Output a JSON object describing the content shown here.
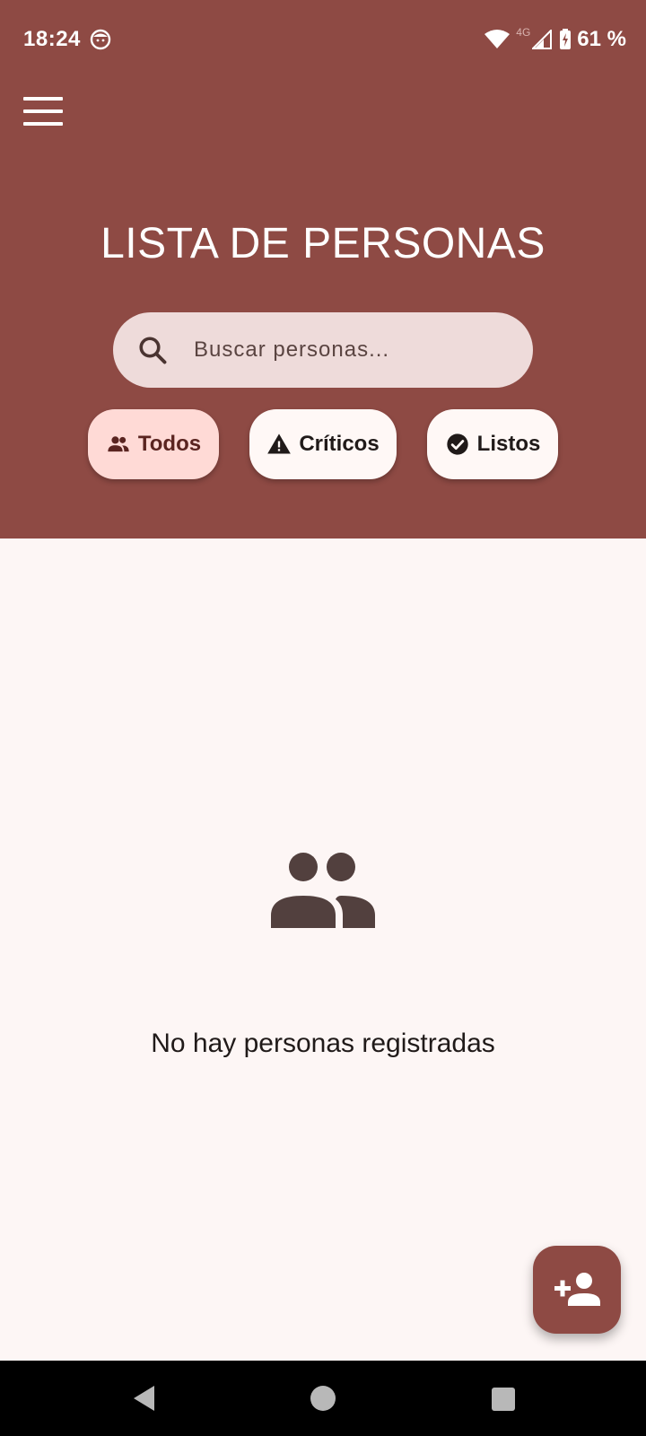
{
  "status_bar": {
    "time": "18:24",
    "network": "4G",
    "battery": "61 %"
  },
  "header": {
    "title": "LISTA DE PERSONAS",
    "search": {
      "placeholder": "Buscar personas...",
      "value": ""
    },
    "filters": [
      {
        "label": "Todos",
        "icon": "group-icon",
        "selected": true
      },
      {
        "label": "Críticos",
        "icon": "warning-icon",
        "selected": false
      },
      {
        "label": "Listos",
        "icon": "check-circle-icon",
        "selected": false
      }
    ]
  },
  "empty_state": {
    "icon": "group-icon",
    "message": "No hay personas registradas"
  },
  "fab": {
    "icon": "person-add-icon"
  },
  "colors": {
    "primary": "#8E4A44",
    "background": "#FDF6F5",
    "search_bg": "#EEDBDA",
    "chip_selected": "#FFDAD6",
    "chip": "#FFF8F6"
  }
}
